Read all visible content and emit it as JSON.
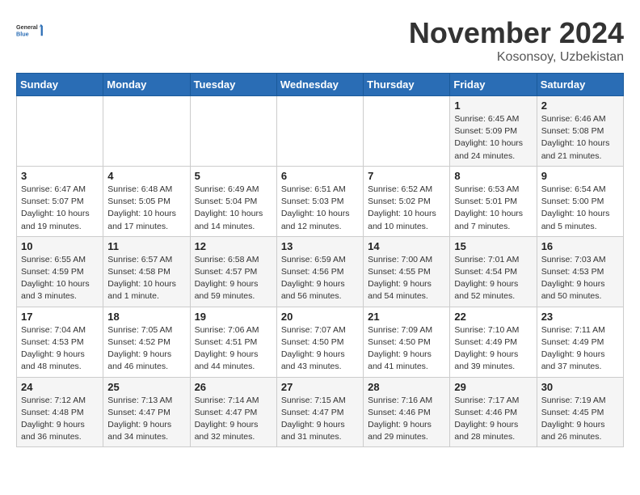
{
  "logo": {
    "line1": "General",
    "line2": "Blue"
  },
  "title": "November 2024",
  "location": "Kosonsoy, Uzbekistan",
  "weekdays": [
    "Sunday",
    "Monday",
    "Tuesday",
    "Wednesday",
    "Thursday",
    "Friday",
    "Saturday"
  ],
  "weeks": [
    [
      {
        "day": "",
        "info": ""
      },
      {
        "day": "",
        "info": ""
      },
      {
        "day": "",
        "info": ""
      },
      {
        "day": "",
        "info": ""
      },
      {
        "day": "",
        "info": ""
      },
      {
        "day": "1",
        "info": "Sunrise: 6:45 AM\nSunset: 5:09 PM\nDaylight: 10 hours and 24 minutes."
      },
      {
        "day": "2",
        "info": "Sunrise: 6:46 AM\nSunset: 5:08 PM\nDaylight: 10 hours and 21 minutes."
      }
    ],
    [
      {
        "day": "3",
        "info": "Sunrise: 6:47 AM\nSunset: 5:07 PM\nDaylight: 10 hours and 19 minutes."
      },
      {
        "day": "4",
        "info": "Sunrise: 6:48 AM\nSunset: 5:05 PM\nDaylight: 10 hours and 17 minutes."
      },
      {
        "day": "5",
        "info": "Sunrise: 6:49 AM\nSunset: 5:04 PM\nDaylight: 10 hours and 14 minutes."
      },
      {
        "day": "6",
        "info": "Sunrise: 6:51 AM\nSunset: 5:03 PM\nDaylight: 10 hours and 12 minutes."
      },
      {
        "day": "7",
        "info": "Sunrise: 6:52 AM\nSunset: 5:02 PM\nDaylight: 10 hours and 10 minutes."
      },
      {
        "day": "8",
        "info": "Sunrise: 6:53 AM\nSunset: 5:01 PM\nDaylight: 10 hours and 7 minutes."
      },
      {
        "day": "9",
        "info": "Sunrise: 6:54 AM\nSunset: 5:00 PM\nDaylight: 10 hours and 5 minutes."
      }
    ],
    [
      {
        "day": "10",
        "info": "Sunrise: 6:55 AM\nSunset: 4:59 PM\nDaylight: 10 hours and 3 minutes."
      },
      {
        "day": "11",
        "info": "Sunrise: 6:57 AM\nSunset: 4:58 PM\nDaylight: 10 hours and 1 minute."
      },
      {
        "day": "12",
        "info": "Sunrise: 6:58 AM\nSunset: 4:57 PM\nDaylight: 9 hours and 59 minutes."
      },
      {
        "day": "13",
        "info": "Sunrise: 6:59 AM\nSunset: 4:56 PM\nDaylight: 9 hours and 56 minutes."
      },
      {
        "day": "14",
        "info": "Sunrise: 7:00 AM\nSunset: 4:55 PM\nDaylight: 9 hours and 54 minutes."
      },
      {
        "day": "15",
        "info": "Sunrise: 7:01 AM\nSunset: 4:54 PM\nDaylight: 9 hours and 52 minutes."
      },
      {
        "day": "16",
        "info": "Sunrise: 7:03 AM\nSunset: 4:53 PM\nDaylight: 9 hours and 50 minutes."
      }
    ],
    [
      {
        "day": "17",
        "info": "Sunrise: 7:04 AM\nSunset: 4:53 PM\nDaylight: 9 hours and 48 minutes."
      },
      {
        "day": "18",
        "info": "Sunrise: 7:05 AM\nSunset: 4:52 PM\nDaylight: 9 hours and 46 minutes."
      },
      {
        "day": "19",
        "info": "Sunrise: 7:06 AM\nSunset: 4:51 PM\nDaylight: 9 hours and 44 minutes."
      },
      {
        "day": "20",
        "info": "Sunrise: 7:07 AM\nSunset: 4:50 PM\nDaylight: 9 hours and 43 minutes."
      },
      {
        "day": "21",
        "info": "Sunrise: 7:09 AM\nSunset: 4:50 PM\nDaylight: 9 hours and 41 minutes."
      },
      {
        "day": "22",
        "info": "Sunrise: 7:10 AM\nSunset: 4:49 PM\nDaylight: 9 hours and 39 minutes."
      },
      {
        "day": "23",
        "info": "Sunrise: 7:11 AM\nSunset: 4:49 PM\nDaylight: 9 hours and 37 minutes."
      }
    ],
    [
      {
        "day": "24",
        "info": "Sunrise: 7:12 AM\nSunset: 4:48 PM\nDaylight: 9 hours and 36 minutes."
      },
      {
        "day": "25",
        "info": "Sunrise: 7:13 AM\nSunset: 4:47 PM\nDaylight: 9 hours and 34 minutes."
      },
      {
        "day": "26",
        "info": "Sunrise: 7:14 AM\nSunset: 4:47 PM\nDaylight: 9 hours and 32 minutes."
      },
      {
        "day": "27",
        "info": "Sunrise: 7:15 AM\nSunset: 4:47 PM\nDaylight: 9 hours and 31 minutes."
      },
      {
        "day": "28",
        "info": "Sunrise: 7:16 AM\nSunset: 4:46 PM\nDaylight: 9 hours and 29 minutes."
      },
      {
        "day": "29",
        "info": "Sunrise: 7:17 AM\nSunset: 4:46 PM\nDaylight: 9 hours and 28 minutes."
      },
      {
        "day": "30",
        "info": "Sunrise: 7:19 AM\nSunset: 4:45 PM\nDaylight: 9 hours and 26 minutes."
      }
    ]
  ]
}
